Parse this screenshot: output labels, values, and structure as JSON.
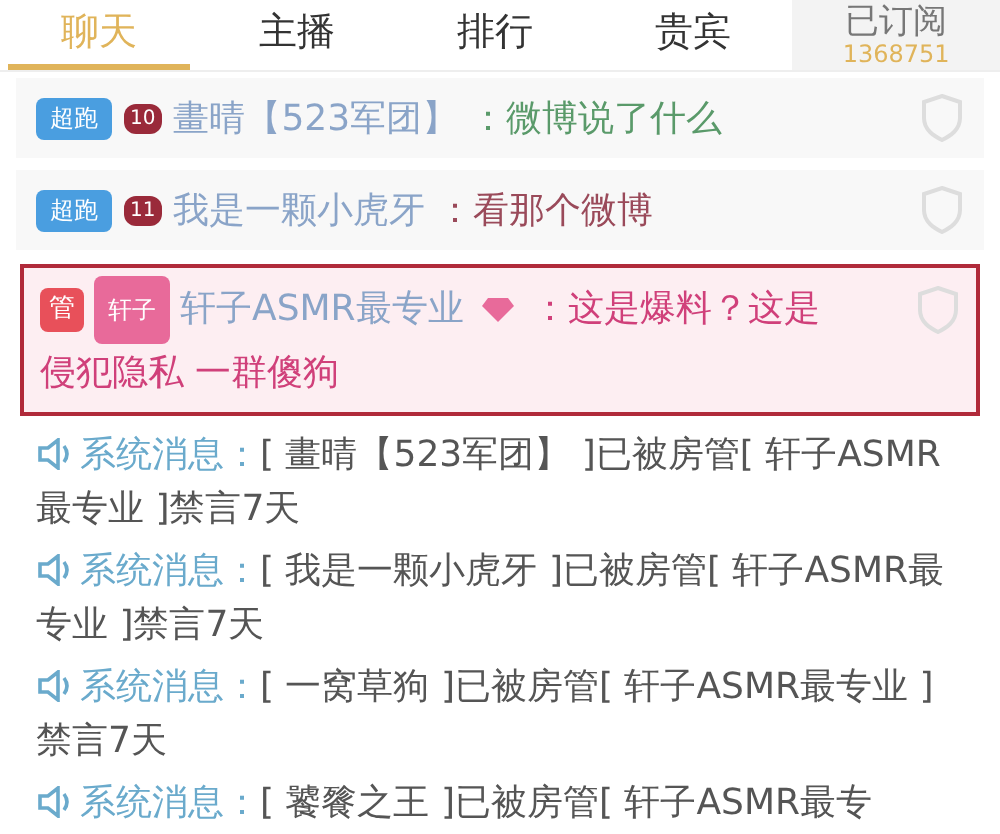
{
  "tabs": [
    {
      "label": "聊天",
      "selected": true
    },
    {
      "label": "主播",
      "selected": false
    },
    {
      "label": "排行",
      "selected": false
    },
    {
      "label": "贵宾",
      "selected": false
    }
  ],
  "subscribe": {
    "label": "已订阅",
    "count": "1368751"
  },
  "messages": [
    {
      "kind": "chat",
      "badge": "超跑",
      "level": "10",
      "user": "畫晴【523军团】",
      "text": "：微博说了什么",
      "color": "#5a9a6a"
    },
    {
      "kind": "chat",
      "badge": "超跑",
      "level": "11",
      "user": "我是一颗小虎牙",
      "text": "：看那个微博",
      "color": "#9a4a5a"
    },
    {
      "kind": "highlight",
      "role": "管",
      "badge": "轩子",
      "user": "轩子ASMR最专业",
      "text_lines": [
        "：这是爆料？这是",
        "侵犯隐私 一群傻狗"
      ],
      "color": "#d0407a"
    },
    {
      "kind": "system",
      "label": "系统消息：",
      "text": "[ 畫晴【523军团】 ]已被房管[ 轩子ASMR最专业 ]禁言7天"
    },
    {
      "kind": "system",
      "label": "系统消息：",
      "text": "[ 我是一颗小虎牙 ]已被房管[ 轩子ASMR最专业 ]禁言7天"
    },
    {
      "kind": "system",
      "label": "系统消息：",
      "text": "[ 一窝草狗 ]已被房管[ 轩子ASMR最专业 ]禁言7天"
    },
    {
      "kind": "system",
      "label": "系统消息：",
      "text": "[ 饕餮之王 ]已被房管[ 轩子ASMR最专"
    }
  ]
}
